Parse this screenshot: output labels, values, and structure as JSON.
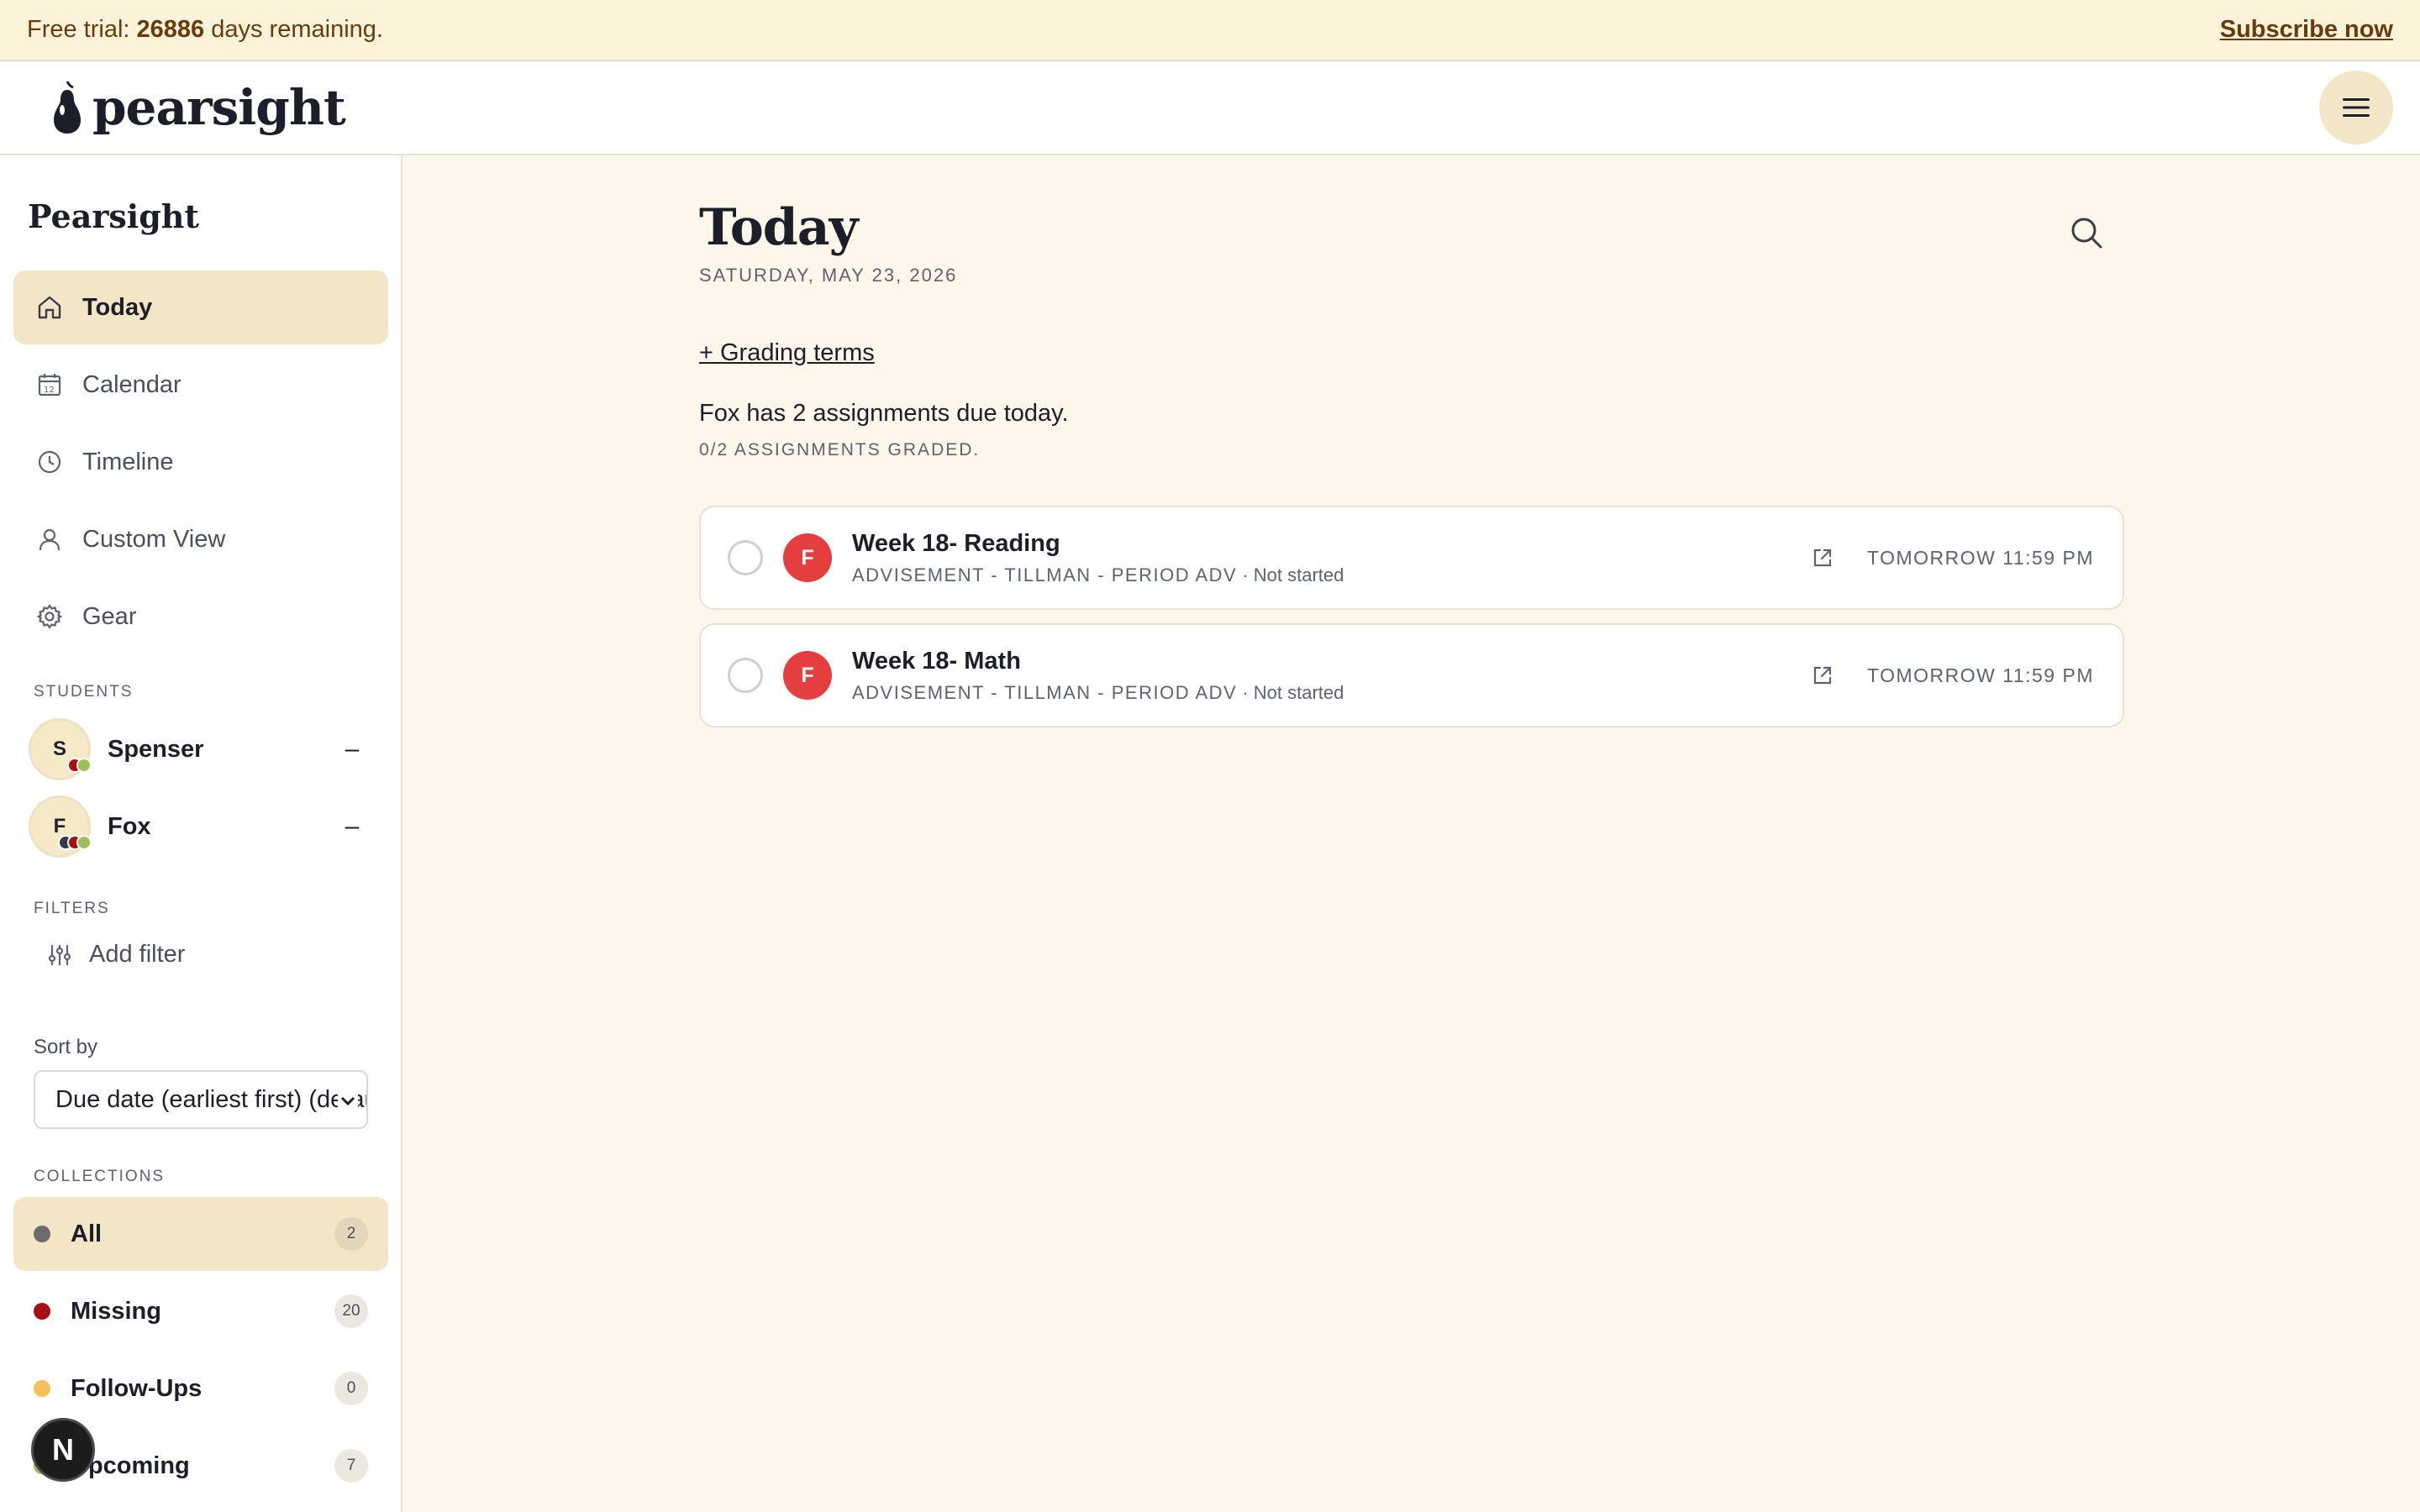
{
  "banner": {
    "prefix": "Free trial: ",
    "days": "26886",
    "suffix": " days remaining.",
    "subscribe": "Subscribe now"
  },
  "header": {
    "logo_text": "pearsight"
  },
  "sidebar": {
    "title": "Pearsight",
    "nav": [
      {
        "label": "Today",
        "icon": "home-icon"
      },
      {
        "label": "Calendar",
        "icon": "calendar-icon"
      },
      {
        "label": "Timeline",
        "icon": "clock-icon"
      },
      {
        "label": "Custom View",
        "icon": "person-icon"
      },
      {
        "label": "Gear",
        "icon": "gear-icon"
      }
    ],
    "students_label": "STUDENTS",
    "students": [
      {
        "initial": "S",
        "name": "Spenser",
        "collapse": "–"
      },
      {
        "initial": "F",
        "name": "Fox",
        "collapse": "–"
      }
    ],
    "filters_label": "FILTERS",
    "add_filter": "Add filter",
    "sort_label": "Sort by",
    "sort_value": "Due date (earliest first) (default)",
    "collections_label": "COLLECTIONS",
    "collections": [
      {
        "name": "All",
        "count": "2",
        "color": "#6b6b6b"
      },
      {
        "name": "Missing",
        "count": "20",
        "color": "#a50f15"
      },
      {
        "name": "Follow-Ups",
        "count": "0",
        "color": "#f5c15a"
      },
      {
        "name": "Upcoming",
        "count": "7",
        "color": "#9dbf5a"
      }
    ],
    "fab_label": "N"
  },
  "main": {
    "title": "Today",
    "date": "SATURDAY, MAY 23, 2026",
    "grading_terms": "+ Grading terms",
    "summary": "Fox has 2 assignments due today.",
    "graded": "0/2 ASSIGNMENTS GRADED.",
    "assignments": [
      {
        "initial": "F",
        "title": "Week 18- Reading",
        "course": "ADVISEMENT - TILLMAN - PERIOD ADV",
        "status": " · Not started",
        "due": "TOMORROW 11:59 PM"
      },
      {
        "initial": "F",
        "title": "Week 18- Math",
        "course": "ADVISEMENT - TILLMAN - PERIOD ADV",
        "status": " · Not started",
        "due": "TOMORROW 11:59 PM"
      }
    ]
  },
  "colors": {
    "accent": "#f3e6c6",
    "background": "#fdf6ea",
    "avatar_red": "#e53e3e"
  }
}
